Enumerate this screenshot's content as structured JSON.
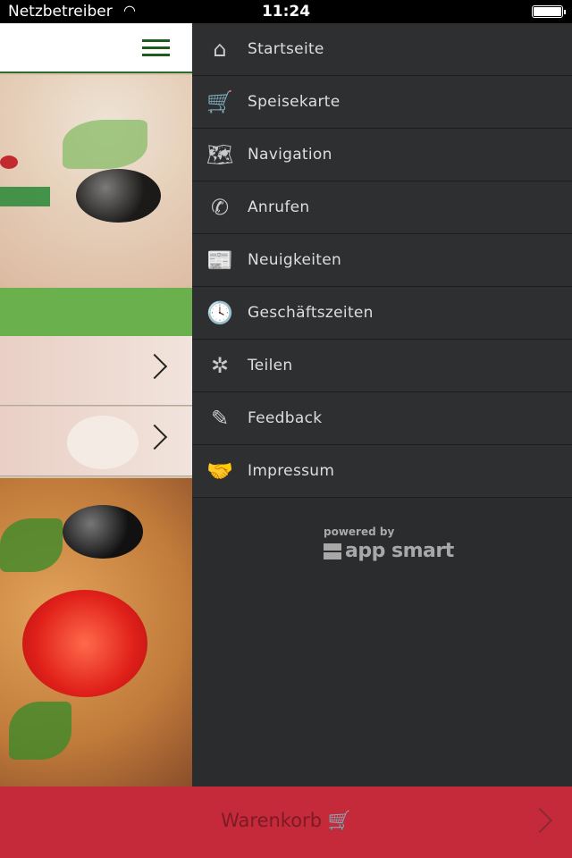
{
  "status": {
    "carrier": "Netzbetreiber",
    "time": "11:24",
    "battery_level": 1.0
  },
  "menu": {
    "items": [
      {
        "label": "Startseite",
        "icon": "home-icon",
        "glyph": "⌂"
      },
      {
        "label": "Speisekarte",
        "icon": "cart-icon",
        "glyph": "🛒"
      },
      {
        "label": "Navigation",
        "icon": "map-icon",
        "glyph": "🗺"
      },
      {
        "label": "Anrufen",
        "icon": "phone-icon",
        "glyph": "✆"
      },
      {
        "label": "Neuigkeiten",
        "icon": "newspaper-icon",
        "glyph": "📰"
      },
      {
        "label": "Geschäftszeiten",
        "icon": "clock-truck-icon",
        "glyph": "🕓"
      },
      {
        "label": "Teilen",
        "icon": "share-icon",
        "glyph": "✲"
      },
      {
        "label": "Feedback",
        "icon": "feedback-icon",
        "glyph": "✎"
      },
      {
        "label": "Impressum",
        "icon": "handshake-icon",
        "glyph": "🤝"
      }
    ]
  },
  "footer": {
    "powered": "powered by",
    "brand": "app smart"
  },
  "cart": {
    "label": "Warenkorb",
    "glyph": "🛒"
  },
  "colors": {
    "menu_bg": "#2b2c2e",
    "cart_bar": "#c42a3a",
    "accent_green": "#6ab04c"
  }
}
